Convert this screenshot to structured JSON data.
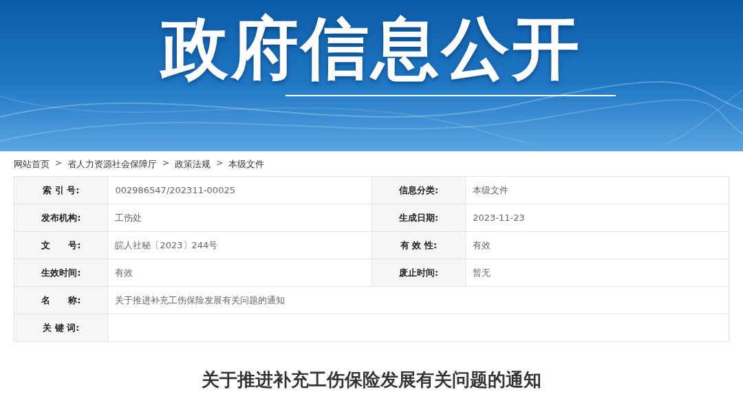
{
  "banner": {
    "title": "政府信息公开"
  },
  "breadcrumb": [
    {
      "kind": "link",
      "label": "网站首页"
    },
    {
      "kind": "separator",
      "label": ">"
    },
    {
      "kind": "link",
      "label": "省人力资源社会保障厅"
    },
    {
      "kind": "separator",
      "label": ">"
    },
    {
      "kind": "link",
      "label": "政策法规"
    },
    {
      "kind": "separator",
      "label": ">"
    },
    {
      "kind": "link",
      "label": "本级文件"
    }
  ],
  "info_table": {
    "rows": [
      {
        "cells": [
          {
            "label": "索 引 号:",
            "value": "002986547/202311-00025"
          },
          {
            "label": "信息分类:",
            "value": "本级文件"
          }
        ]
      },
      {
        "cells": [
          {
            "label": "发布机构:",
            "value": "工伤处"
          },
          {
            "label": "生成日期:",
            "value": "2023-11-23"
          }
        ]
      },
      {
        "cells": [
          {
            "label": "文　　号:",
            "value": "皖人社秘〔2023〕244号"
          },
          {
            "label": "有 效 性:",
            "value": "有效"
          }
        ]
      },
      {
        "cells": [
          {
            "label": "生效时间:",
            "value": "有效"
          },
          {
            "label": "废止时间:",
            "value": "暂无"
          }
        ]
      },
      {
        "cells": [
          {
            "label": "名　　称:",
            "value": "关于推进补充工伤保险发展有关问题的通知"
          }
        ]
      },
      {
        "cells": [
          {
            "label": "关 键 词:"
          }
        ]
      }
    ]
  },
  "article": {
    "title": "关于推进补充工伤保险发展有关问题的通知"
  }
}
